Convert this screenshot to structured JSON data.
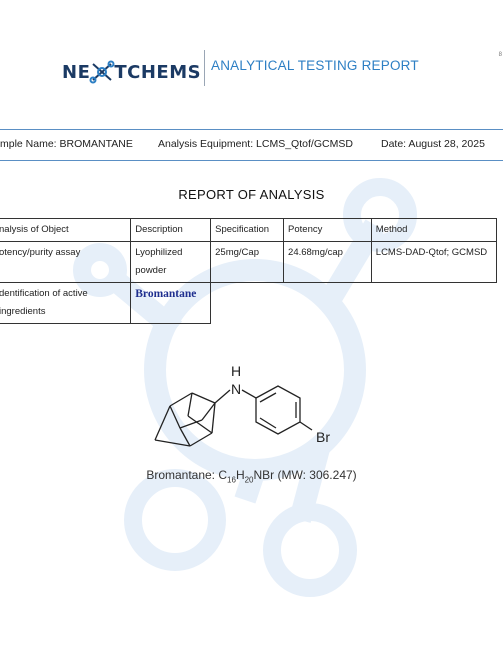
{
  "header": {
    "logo_text_left": "NE",
    "logo_text_right": "TCHEMS",
    "report_title": "ANALYTICAL TESTING REPORT",
    "corner_mark": "8"
  },
  "info_bar": {
    "sample": "mple Name: BROMANTANE",
    "equipment": "Analysis Equipment: LCMS_Qtof/GCMSD",
    "date": "Date: August 28, 2025"
  },
  "report_heading": "REPORT OF ANALYSIS",
  "table": {
    "headers": [
      "nalysis of Object",
      "Description",
      "Specification",
      "Potency",
      "Method"
    ],
    "row1": {
      "object": "otency/purity assay",
      "description": "Lyophilized powder",
      "specification": "25mg/Cap",
      "potency": "24.68mg/cap",
      "method": "LCMS-DAD-Qtof; GCMSD"
    },
    "row2": {
      "object": "dentification of active ingredients",
      "description": "Bromantane"
    }
  },
  "structure": {
    "nh_label": "N",
    "h_label": "H",
    "br_label": "Br"
  },
  "caption": {
    "name": "Bromantane: C",
    "sub1": "16",
    "mid": "H",
    "sub2": "20",
    "rest": "NBr (MW: 306.247)"
  },
  "colors": {
    "accent_blue": "#2d7fc4",
    "logo_navy": "#1b3a64",
    "watermark": "#eaf2fb",
    "rule_blue": "#5a8fc4"
  }
}
